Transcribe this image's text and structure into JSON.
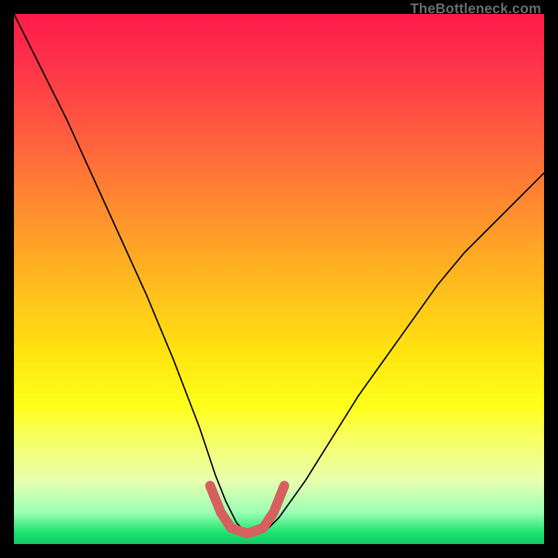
{
  "watermark": {
    "text": "TheBottleneck.com"
  },
  "chart_data": {
    "type": "line",
    "title": "",
    "xlabel": "",
    "ylabel": "",
    "xlim": [
      0,
      100
    ],
    "ylim": [
      0,
      100
    ],
    "series": [
      {
        "name": "curve",
        "x": [
          0,
          5,
          10,
          15,
          20,
          25,
          30,
          35,
          38,
          40,
          42,
          44,
          46,
          48,
          50,
          55,
          60,
          65,
          70,
          75,
          80,
          85,
          90,
          95,
          100
        ],
        "values": [
          100,
          90,
          80,
          69,
          58,
          47,
          35,
          22,
          13,
          8,
          4,
          2,
          2,
          3,
          5,
          12,
          20,
          28,
          35,
          42,
          49,
          55,
          60,
          65,
          70
        ]
      },
      {
        "name": "highlight-flat",
        "x": [
          37,
          39,
          41,
          44,
          47,
          49,
          51
        ],
        "values": [
          11,
          6,
          3,
          2,
          3,
          6,
          11
        ]
      }
    ],
    "colors": {
      "curve": "#000000",
      "highlight": "#d6605f"
    }
  }
}
